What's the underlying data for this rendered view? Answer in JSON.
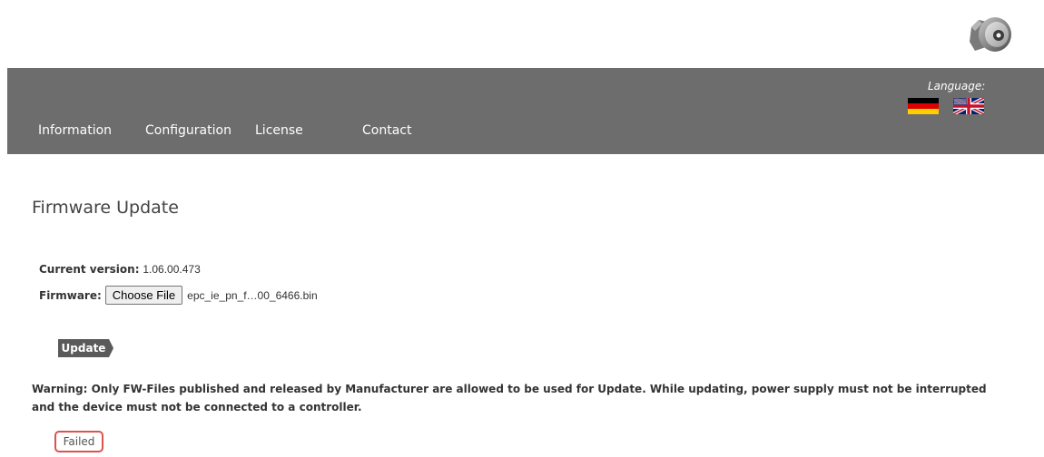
{
  "brand": {
    "logo_icon": "rotary-encoder-icon"
  },
  "nav": {
    "items": [
      {
        "label": "Information"
      },
      {
        "label": "Configuration"
      },
      {
        "label": "License"
      },
      {
        "label": "Contact"
      }
    ],
    "language": {
      "label": "Language:",
      "flags": [
        {
          "icon": "flag-de-icon",
          "colors": [
            "#000000",
            "#dd0000",
            "#ffce00"
          ]
        },
        {
          "icon": "flag-uk-icon",
          "colors": [
            "#012169",
            "#ffffff",
            "#c8102e"
          ]
        }
      ]
    },
    "background": "#6d6d6d"
  },
  "page": {
    "title": "Firmware Update"
  },
  "form": {
    "current_version_label": "Current version:",
    "current_version_value": "1.06.00.473",
    "firmware_label": "Firmware:",
    "choose_file_label": "Choose File",
    "selected_file": "epc_ie_pn_f…00_6466.bin",
    "update_label": "Update"
  },
  "warning": {
    "text": "Warning: Only FW-Files published and released by Manufacturer are allowed to be used for Update. While updating, power supply must not be interrupted and the device must not be connected to a controller."
  },
  "status": {
    "text": "Failed",
    "color": "#d9534f"
  }
}
